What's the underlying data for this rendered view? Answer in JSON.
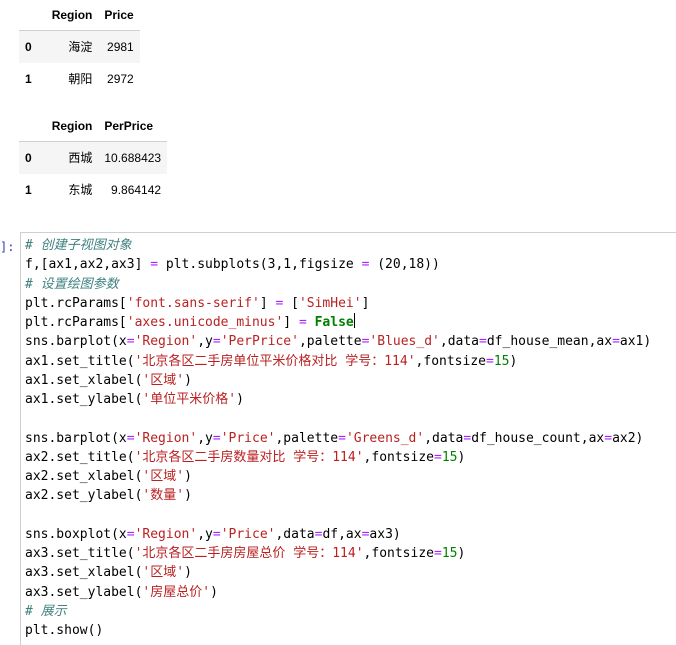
{
  "table1": {
    "headers": [
      "Region",
      "Price"
    ],
    "rows": [
      {
        "index": "0",
        "region": "海淀",
        "value": "2981"
      },
      {
        "index": "1",
        "region": "朝阳",
        "value": "2972"
      }
    ]
  },
  "table2": {
    "headers": [
      "Region",
      "PerPrice"
    ],
    "rows": [
      {
        "index": "0",
        "region": "西城",
        "value": "10.688423"
      },
      {
        "index": "1",
        "region": "东城",
        "value": "9.864142"
      }
    ]
  },
  "cell": {
    "prompt": "]:",
    "lines": [
      [
        {
          "t": "# 创建子视图对象",
          "c": "cm"
        }
      ],
      [
        {
          "t": "f,[ax1,ax2,ax3] "
        },
        {
          "t": "=",
          "c": "op"
        },
        {
          "t": " plt.subplots(3,1,figsize "
        },
        {
          "t": "=",
          "c": "op"
        },
        {
          "t": " (20,18))"
        }
      ],
      [
        {
          "t": "# 设置绘图参数",
          "c": "cm"
        }
      ],
      [
        {
          "t": "plt.rcParams["
        },
        {
          "t": "'font.sans-serif'",
          "c": "st"
        },
        {
          "t": "] "
        },
        {
          "t": "=",
          "c": "op"
        },
        {
          "t": " ["
        },
        {
          "t": "'SimHei'",
          "c": "st"
        },
        {
          "t": "]"
        }
      ],
      [
        {
          "t": "plt.rcParams["
        },
        {
          "t": "'axes.unicode_minus'",
          "c": "st"
        },
        {
          "t": "] "
        },
        {
          "t": "=",
          "c": "op"
        },
        {
          "t": " "
        },
        {
          "t": "False",
          "c": "bool"
        }
      ],
      [
        {
          "t": "sns.barplot(x"
        },
        {
          "t": "=",
          "c": "op"
        },
        {
          "t": "'Region'",
          "c": "st"
        },
        {
          "t": ",y"
        },
        {
          "t": "=",
          "c": "op"
        },
        {
          "t": "'PerPrice'",
          "c": "st"
        },
        {
          "t": ",palette"
        },
        {
          "t": "=",
          "c": "op"
        },
        {
          "t": "'Blues_d'",
          "c": "st"
        },
        {
          "t": ",data"
        },
        {
          "t": "=",
          "c": "op"
        },
        {
          "t": "df_house_mean,ax"
        },
        {
          "t": "=",
          "c": "op"
        },
        {
          "t": "ax1)"
        }
      ],
      [
        {
          "t": "ax1.set_title("
        },
        {
          "t": "'北京各区二手房单位平米价格对比 学号：114'",
          "c": "st"
        },
        {
          "t": ",fontsize"
        },
        {
          "t": "=",
          "c": "op"
        },
        {
          "t": "15",
          "c": "nm"
        },
        {
          "t": ")"
        }
      ],
      [
        {
          "t": "ax1.set_xlabel("
        },
        {
          "t": "'区域'",
          "c": "st"
        },
        {
          "t": ")"
        }
      ],
      [
        {
          "t": "ax1.set_ylabel("
        },
        {
          "t": "'单位平米价格'",
          "c": "st"
        },
        {
          "t": ")"
        }
      ],
      [],
      [
        {
          "t": "sns.barplot(x"
        },
        {
          "t": "=",
          "c": "op"
        },
        {
          "t": "'Region'",
          "c": "st"
        },
        {
          "t": ",y"
        },
        {
          "t": "=",
          "c": "op"
        },
        {
          "t": "'Price'",
          "c": "st"
        },
        {
          "t": ",palette"
        },
        {
          "t": "=",
          "c": "op"
        },
        {
          "t": "'Greens_d'",
          "c": "st"
        },
        {
          "t": ",data"
        },
        {
          "t": "=",
          "c": "op"
        },
        {
          "t": "df_house_count,ax"
        },
        {
          "t": "=",
          "c": "op"
        },
        {
          "t": "ax2)"
        }
      ],
      [
        {
          "t": "ax2.set_title("
        },
        {
          "t": "'北京各区二手房数量对比 学号：114'",
          "c": "st"
        },
        {
          "t": ",fontsize"
        },
        {
          "t": "=",
          "c": "op"
        },
        {
          "t": "15",
          "c": "nm"
        },
        {
          "t": ")"
        }
      ],
      [
        {
          "t": "ax2.set_xlabel("
        },
        {
          "t": "'区域'",
          "c": "st"
        },
        {
          "t": ")"
        }
      ],
      [
        {
          "t": "ax2.set_ylabel("
        },
        {
          "t": "'数量'",
          "c": "st"
        },
        {
          "t": ")"
        }
      ],
      [],
      [
        {
          "t": "sns.boxplot(x"
        },
        {
          "t": "=",
          "c": "op"
        },
        {
          "t": "'Region'",
          "c": "st"
        },
        {
          "t": ",y"
        },
        {
          "t": "=",
          "c": "op"
        },
        {
          "t": "'Price'",
          "c": "st"
        },
        {
          "t": ",data"
        },
        {
          "t": "=",
          "c": "op"
        },
        {
          "t": "df,ax"
        },
        {
          "t": "=",
          "c": "op"
        },
        {
          "t": "ax3)"
        }
      ],
      [
        {
          "t": "ax3.set_title("
        },
        {
          "t": "'北京各区二手房房屋总价 学号：114'",
          "c": "st"
        },
        {
          "t": ",fontsize"
        },
        {
          "t": "=",
          "c": "op"
        },
        {
          "t": "15",
          "c": "nm"
        },
        {
          "t": ")"
        }
      ],
      [
        {
          "t": "ax3.set_xlabel("
        },
        {
          "t": "'区域'",
          "c": "st"
        },
        {
          "t": ")"
        }
      ],
      [
        {
          "t": "ax3.set_ylabel("
        },
        {
          "t": "'房屋总价'",
          "c": "st"
        },
        {
          "t": ")"
        }
      ],
      [
        {
          "t": "# 展示",
          "c": "cm"
        }
      ],
      [
        {
          "t": "plt.show()"
        }
      ]
    ]
  }
}
